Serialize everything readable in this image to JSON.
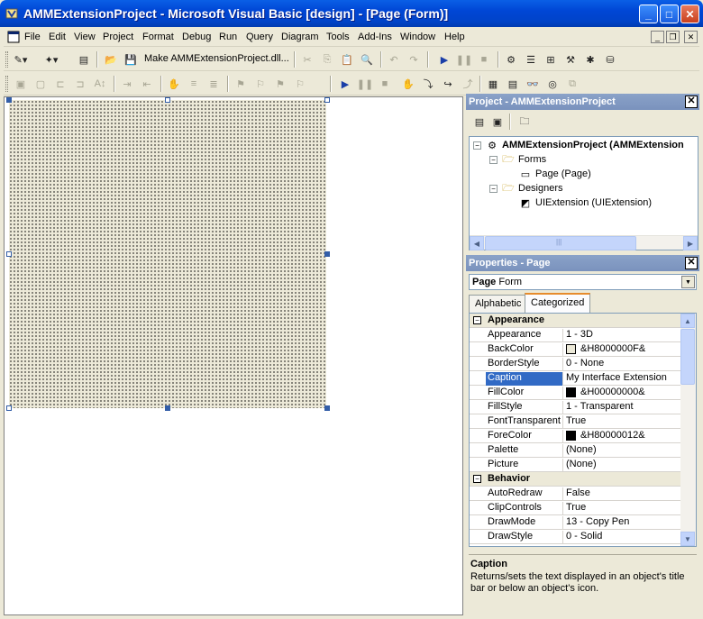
{
  "window": {
    "title": "AMMExtensionProject - Microsoft Visual Basic [design] - [Page (Form)]",
    "min_label": "_",
    "max_label": "□",
    "close_label": "✕"
  },
  "menubar": {
    "items": [
      "File",
      "Edit",
      "View",
      "Project",
      "Format",
      "Debug",
      "Run",
      "Query",
      "Diagram",
      "Tools",
      "Add-Ins",
      "Window",
      "Help"
    ],
    "mdi_min": "_",
    "mdi_restore": "❐",
    "mdi_close": "✕"
  },
  "toolbar": {
    "make_label": "Make AMMExtensionProject.dll..."
  },
  "project_panel": {
    "title": "Project - AMMExtensionProject",
    "close_label": "✕",
    "tree": {
      "root": "AMMExtensionProject (AMMExtension",
      "forms_folder": "Forms",
      "page_item": "Page (Page)",
      "designers_folder": "Designers",
      "uiextension_item": "UIExtension (UIExtension)"
    },
    "scroll_grip": "|||"
  },
  "properties_panel": {
    "title": "Properties - Page",
    "close_label": "✕",
    "object_name": "Page",
    "object_type": "Form",
    "tabs": [
      "Alphabetic",
      "Categorized"
    ],
    "active_tab": "Categorized",
    "categories": [
      {
        "name": "Appearance",
        "rows": [
          {
            "name": "Appearance",
            "value": "1 - 3D"
          },
          {
            "name": "BackColor",
            "value": "&H8000000F&",
            "swatch": "#ece9d8"
          },
          {
            "name": "BorderStyle",
            "value": "0 - None"
          },
          {
            "name": "Caption",
            "value": "My Interface Extension",
            "selected": true
          },
          {
            "name": "FillColor",
            "value": "&H00000000&",
            "swatch": "#000000"
          },
          {
            "name": "FillStyle",
            "value": "1 - Transparent"
          },
          {
            "name": "FontTransparent",
            "value": "True"
          },
          {
            "name": "ForeColor",
            "value": "&H80000012&",
            "swatch": "#000000"
          },
          {
            "name": "Palette",
            "value": "(None)"
          },
          {
            "name": "Picture",
            "value": "(None)"
          }
        ]
      },
      {
        "name": "Behavior",
        "rows": [
          {
            "name": "AutoRedraw",
            "value": "False"
          },
          {
            "name": "ClipControls",
            "value": "True"
          },
          {
            "name": "DrawMode",
            "value": "13 - Copy Pen"
          },
          {
            "name": "DrawStyle",
            "value": "0 - Solid"
          }
        ]
      }
    ],
    "description": {
      "title": "Caption",
      "text": "Returns/sets the text displayed in an object's title bar or below an object's icon."
    }
  },
  "colors": {
    "title_blue": "#0046d5",
    "selection": "#316ac5",
    "panel_title": "#7a92bd"
  }
}
